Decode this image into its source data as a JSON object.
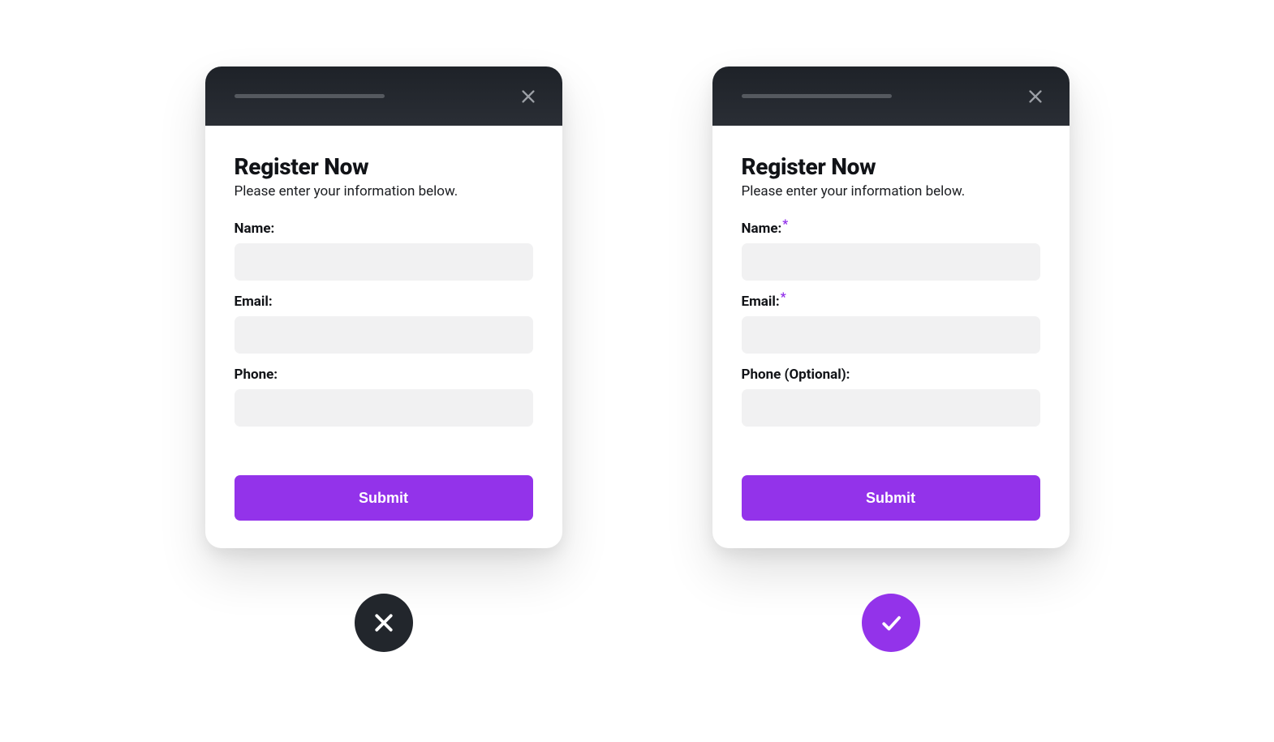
{
  "colors": {
    "accent": "#9333ea",
    "header_bg": "#22262c",
    "input_bg": "#f1f1f2"
  },
  "left": {
    "verdict": "bad",
    "title": "Register Now",
    "subtitle": "Please enter your information below.",
    "fields": {
      "name": {
        "label": "Name:",
        "value": "",
        "required_marker": ""
      },
      "email": {
        "label": "Email:",
        "value": "",
        "required_marker": ""
      },
      "phone": {
        "label": "Phone:",
        "value": "",
        "required_marker": ""
      }
    },
    "submit_label": "Submit"
  },
  "right": {
    "verdict": "good",
    "title": "Register Now",
    "subtitle": "Please enter your information below.",
    "fields": {
      "name": {
        "label": "Name:",
        "value": "",
        "required_marker": "*"
      },
      "email": {
        "label": "Email:",
        "value": "",
        "required_marker": "*"
      },
      "phone": {
        "label": "Phone (Optional):",
        "value": "",
        "required_marker": ""
      }
    },
    "submit_label": "Submit"
  }
}
